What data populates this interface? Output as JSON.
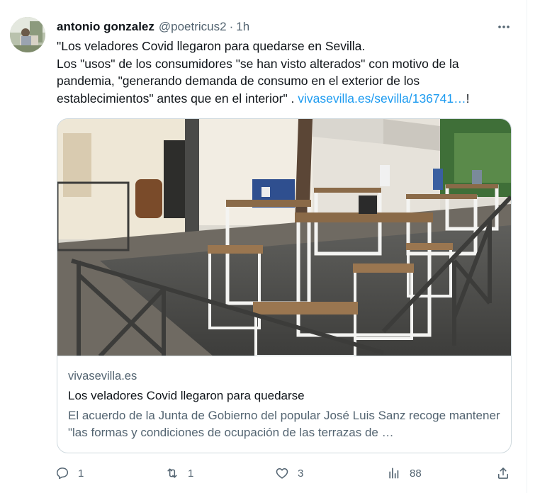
{
  "author": {
    "name": "antonio gonzalez",
    "handle": "@poetricus2",
    "separator": "·",
    "time": "1h"
  },
  "tweet": {
    "line1": "\"Los veladores Covid llegaron para quedarse en Sevilla.",
    "line2": "Los \"usos\" de los consumidores \"se han visto alterados\" con motivo de la pandemia, \"generando demanda de consumo en el exterior de los establecimientos\" antes que en el interior\" .",
    "link": "vivasevilla.es/sevilla/136741…",
    "trailing": "!"
  },
  "card": {
    "domain": "vivasevilla.es",
    "title": "Los veladores Covid llegaron para quedarse",
    "description": "El acuerdo de la Junta de Gobierno del popular José Luis Sanz recoge mantener \"las formas y condiciones de ocupación de las terrazas de …"
  },
  "actions": {
    "replies": "1",
    "retweets": "1",
    "likes": "3",
    "views": "88"
  },
  "icons": {
    "more": "more-icon",
    "reply": "reply-icon",
    "retweet": "retweet-icon",
    "like": "heart-icon",
    "views": "views-icon",
    "share": "share-icon"
  },
  "colors": {
    "link": "#1d9bf0",
    "secondary": "#536471",
    "primary": "#0f1419",
    "border": "#cfd9de"
  }
}
